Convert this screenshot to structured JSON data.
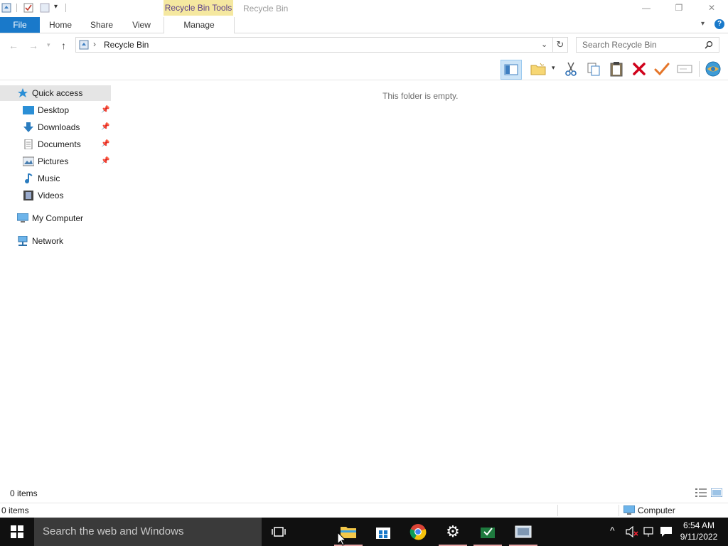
{
  "window": {
    "title": "Recycle Bin",
    "contextual_tab_group": "Recycle Bin Tools",
    "controls": {
      "minimize": "—",
      "restore": "❐",
      "close": "✕"
    }
  },
  "ribbon": {
    "tabs": [
      {
        "label": "File"
      },
      {
        "label": "Home"
      },
      {
        "label": "Share"
      },
      {
        "label": "View"
      },
      {
        "label": "Manage"
      }
    ],
    "help": "?"
  },
  "address": {
    "separator": "›",
    "path": "Recycle Bin",
    "search_placeholder": "Search Recycle Bin"
  },
  "nav_pane": {
    "quick_access": "Quick access",
    "items": [
      {
        "label": "Desktop",
        "icon": "desktop-icon",
        "pinned": true
      },
      {
        "label": "Downloads",
        "icon": "downloads-icon",
        "pinned": true
      },
      {
        "label": "Documents",
        "icon": "documents-icon",
        "pinned": true
      },
      {
        "label": "Pictures",
        "icon": "pictures-icon",
        "pinned": true
      },
      {
        "label": "Music",
        "icon": "music-icon",
        "pinned": false
      },
      {
        "label": "Videos",
        "icon": "videos-icon",
        "pinned": false
      }
    ],
    "my_computer": "My Computer",
    "network": "Network"
  },
  "content": {
    "empty_message": "This folder is empty."
  },
  "status_bar": {
    "item_count": "0 items"
  },
  "details_bar": {
    "item_count": "0 items",
    "location": "Computer"
  },
  "taskbar": {
    "search_placeholder": "Search the web and Windows",
    "time": "6:54 AM",
    "date": "9/11/2022"
  },
  "colors": {
    "file_tab": "#1979ca",
    "contextual_tab": "#f5e8a0",
    "taskbar": "#101010",
    "selection": "#e5e5e5"
  }
}
